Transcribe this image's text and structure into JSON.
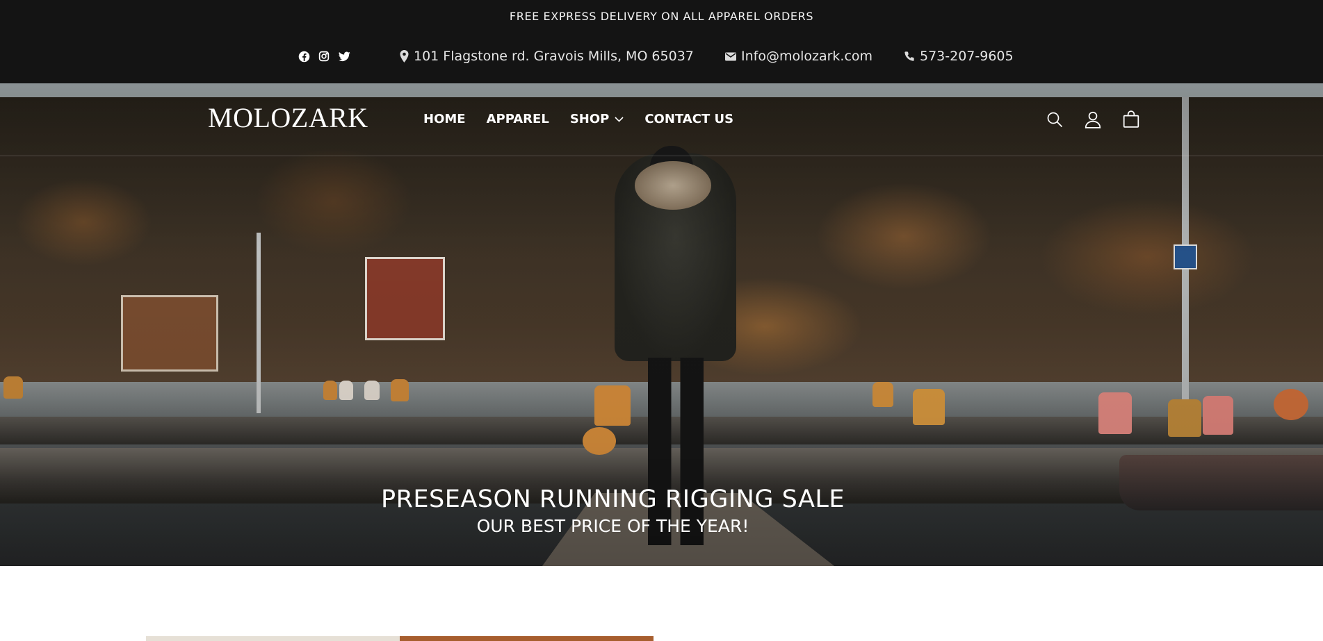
{
  "announcement": {
    "text": "FREE EXPRESS DELIVERY ON ALL APPAREL ORDERS"
  },
  "contact": {
    "social": [
      "facebook-icon",
      "instagram-icon",
      "twitter-icon"
    ],
    "address": "101 Flagstone rd. Gravois Mills, MO 65037",
    "email": "Info@molozark.com",
    "phone": "573-207-9605"
  },
  "header": {
    "logo": "MOLOZARK",
    "nav": [
      {
        "label": "HOME"
      },
      {
        "label": "APPAREL"
      },
      {
        "label": "SHOP",
        "has_dropdown": true
      },
      {
        "label": "CONTACT US"
      }
    ],
    "icons": [
      "search-icon",
      "account-icon",
      "cart-icon"
    ]
  },
  "hero": {
    "title": "PRESEASON RUNNING RIGGING SALE",
    "subtitle": "OUR BEST PRICE OF THE YEAR!"
  },
  "colors": {
    "topbar_bg": "#141414",
    "text_light": "#ffffff",
    "accent_rust": "#a75e2e"
  }
}
